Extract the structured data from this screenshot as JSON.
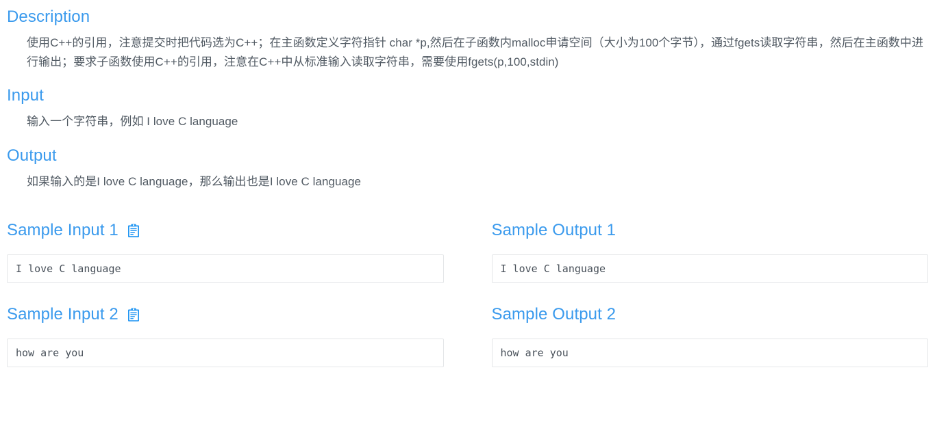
{
  "sections": {
    "description": {
      "title": "Description",
      "text": "使用C++的引用，注意提交时把代码选为C++；在主函数定义字符指针 char *p,然后在子函数内malloc申请空间（大小为100个字节），通过fgets读取字符串，然后在主函数中进行输出；要求子函数使用C++的引用，注意在C++中从标准输入读取字符串，需要使用fgets(p,100,stdin)"
    },
    "input": {
      "title": "Input",
      "text": "输入一个字符串，例如 I love C language"
    },
    "output": {
      "title": "Output",
      "text": "如果输入的是I love C language，那么输出也是I love C language"
    }
  },
  "samples": [
    {
      "input_title": "Sample Input 1",
      "input_value": "I love C language",
      "input_copy_icon": "clipboard-copy-icon",
      "output_title": "Sample Output 1",
      "output_value": "I love C language"
    },
    {
      "input_title": "Sample Input 2",
      "input_value": "how are you",
      "input_copy_icon": "clipboard-copy-icon",
      "output_title": "Sample Output 2",
      "output_value": "how are you"
    }
  ],
  "colors": {
    "heading_blue": "#3a9aed",
    "body_text": "#515a63",
    "box_border": "#e4e6e8",
    "code_text": "#485059"
  }
}
